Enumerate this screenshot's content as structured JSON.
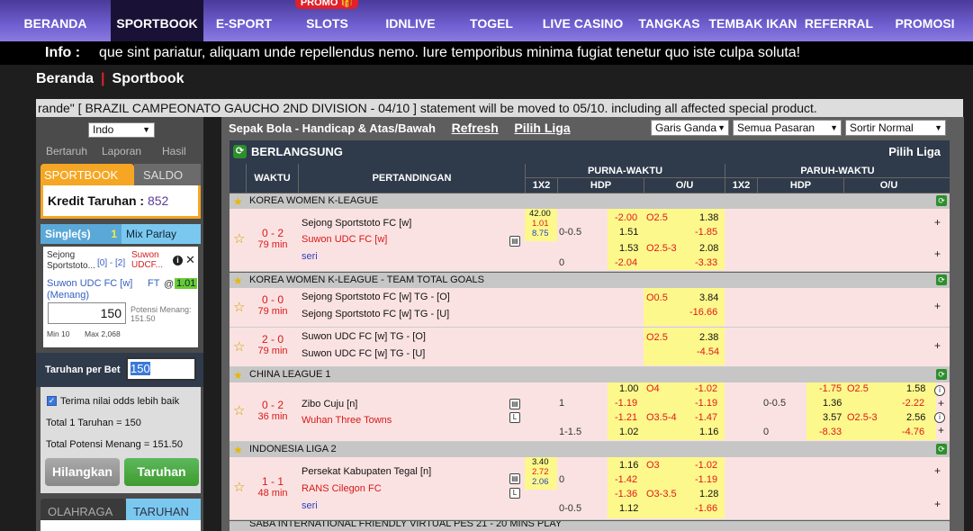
{
  "nav": {
    "items": [
      "BERANDA",
      "SPORTBOOK",
      "E-SPORT",
      "SLOTS",
      "IDNLIVE",
      "TOGEL",
      "LIVE CASINO",
      "TANGKAS",
      "TEMBAK IKAN",
      "REFERRAL",
      "PROMOSI"
    ],
    "promo_badge": "PROMO"
  },
  "info": {
    "label": "Info :",
    "text": "que sint pariatur, aliquam unde repellendus nemo. Iure temporibus minima fugiat tenetur quo iste culpa soluta!"
  },
  "breadcrumb": {
    "home": "Beranda",
    "sep": "|",
    "current": "Sportbook"
  },
  "ticker": "rande\" [ BRAZIL CAMPEONATO GAUCHO 2ND DIVISION - 04/10 ] statement will be moved to 05/10. including all affected special product.",
  "sidebar": {
    "language": "Indo",
    "subtabs": [
      "Bertaruh",
      "Laporan",
      "Hasil"
    ],
    "tab_sportbook": "SPORTBOOK",
    "tab_saldo": "SALDO",
    "kredit_label": "Kredit Taruhan :",
    "kredit_value": "852",
    "single_label": "Single(s)",
    "single_count": "1",
    "parlay_label": "Mix Parlay",
    "slip": {
      "home": "Sejong Sportstoto...",
      "hdp": "[0] - [2]",
      "away": "Suwon UDCF...",
      "pick": "Suwon UDC FC [w] (Menang)",
      "ft": "FT",
      "at": "@",
      "odds": "1.01",
      "stake": "150",
      "potensi": "Potensi Menang: 151.50",
      "min": "Min 10",
      "max": "Max 2,068"
    },
    "per_bet_label": "Taruhan per Bet",
    "per_bet_value": "150",
    "accept_odds": "Terima nilai odds lebih baik",
    "total_bet": "Total 1 Taruhan = 150",
    "total_win": "Total Potensi Menang = 151.50",
    "btn_clear": "Hilangkan",
    "btn_bet": "Taruhan",
    "tab_olahraga": "OLAHRAGA",
    "tab_taruhan": "TARUHAN"
  },
  "main": {
    "title": "Sepak Bola - Handicap & Atas/Bawah",
    "refresh": "Refresh",
    "pilih_liga": "Pilih Liga",
    "dd1": "Garis Ganda",
    "dd2": "Semua Pasaran",
    "dd3": "Sortir Normal",
    "live_title": "BERLANGSUNG",
    "live_pilih": "Pilih Liga",
    "cols": {
      "waktu": "WAKTU",
      "pertandingan": "PERTANDINGAN",
      "full": "PURNA-WAKTU",
      "half": "PARUH-WAKTU",
      "x12": "1X2",
      "hdp": "HDP",
      "ou": "O/U"
    },
    "leagues": [
      "KOREA WOMEN K-LEAGUE",
      "KOREA WOMEN K-LEAGUE - TEAM TOTAL GOALS",
      "CHINA LEAGUE 1",
      "INDONESIA LIGA 2",
      "SABA INTERNATIONAL FRIENDLY VIRTUAL PES 21 - 20 MINS PLAY"
    ],
    "m1": {
      "score": "0 - 2",
      "min": "79 min",
      "home": "Sejong Sportstoto FC [w]",
      "away": "Suwon UDC FC [w]",
      "draw": "seri",
      "x12": [
        "42.00",
        "1.01",
        "8.75"
      ],
      "r1": {
        "hdp_o": "-2.00",
        "ou_l": "O2.5",
        "ou_o": "1.38"
      },
      "r2": {
        "hdp_l": "0-0.5",
        "hdp_o": "1.51",
        "ou_o": "-1.85"
      },
      "r3": {
        "hdp_o": "1.53",
        "ou_l": "O2.5-3",
        "ou_o": "2.08"
      },
      "r4": {
        "hdp_l": "0",
        "hdp_o": "-2.04",
        "ou_o": "-3.33"
      }
    },
    "m2": {
      "score": "0 - 0",
      "min": "79 min",
      "home": "Sejong Sportstoto FC [w] TG - [O]",
      "away": "Sejong Sportstoto FC [w] TG - [U]",
      "ou_l": "O0.5",
      "o1": "3.84",
      "o2": "-16.66"
    },
    "m3": {
      "score": "2 - 0",
      "min": "79 min",
      "home": "Suwon UDC FC [w] TG - [O]",
      "away": "Suwon UDC FC [w] TG - [U]",
      "ou_l": "O2.5",
      "o1": "2.38",
      "o2": "-4.54"
    },
    "m4": {
      "score": "0 - 2",
      "min": "36 min",
      "home": "Zibo Cuju [n]",
      "away": "Wuhan Three Towns",
      "f1": {
        "hdp_o": "1.00",
        "ou_l": "O4",
        "ou_o": "-1.02"
      },
      "f2": {
        "hdp_l": "1",
        "hdp_o": "-1.19",
        "ou_o": "-1.19"
      },
      "f3": {
        "hdp_o": "-1.21",
        "ou_l": "O3.5-4",
        "ou_o": "-1.47"
      },
      "f4": {
        "hdp_l": "1-1.5",
        "hdp_o": "1.02",
        "ou_o": "1.16"
      },
      "h1": {
        "hdp_o": "-1.75",
        "ou_l": "O2.5",
        "ou_o": "1.58"
      },
      "h2": {
        "hdp_l": "0-0.5",
        "hdp_o": "1.36",
        "ou_o": "-2.22"
      },
      "h3": {
        "hdp_o": "3.57",
        "ou_l": "O2.5-3",
        "ou_o": "2.56"
      },
      "h4": {
        "hdp_l": "0",
        "hdp_o": "-8.33",
        "ou_o": "-4.76"
      }
    },
    "m5": {
      "score": "1 - 1",
      "min": "48 min",
      "home": "Persekat Kabupaten Tegal [n]",
      "away": "RANS Cilegon FC",
      "draw": "seri",
      "x12": [
        "3.40",
        "2.72",
        "2.06"
      ],
      "r1": {
        "hdp_o": "1.16",
        "ou_l": "O3",
        "ou_o": "-1.02"
      },
      "r2": {
        "hdp_l": "0",
        "hdp_o": "-1.42",
        "ou_o": "-1.19"
      },
      "r3": {
        "hdp_o": "-1.36",
        "ou_l": "O3-3.5",
        "ou_o": "1.28"
      },
      "r4": {
        "hdp_l": "0-0.5",
        "hdp_o": "1.12",
        "ou_o": "-1.66"
      }
    }
  },
  "colors": {
    "nav": "#6f5fd0",
    "accent": "#f5a623",
    "live_header": "#2f3a4a",
    "row": "#fbe2e2",
    "odds_bg": "#fdf88c",
    "win": "#3e9c2e"
  }
}
